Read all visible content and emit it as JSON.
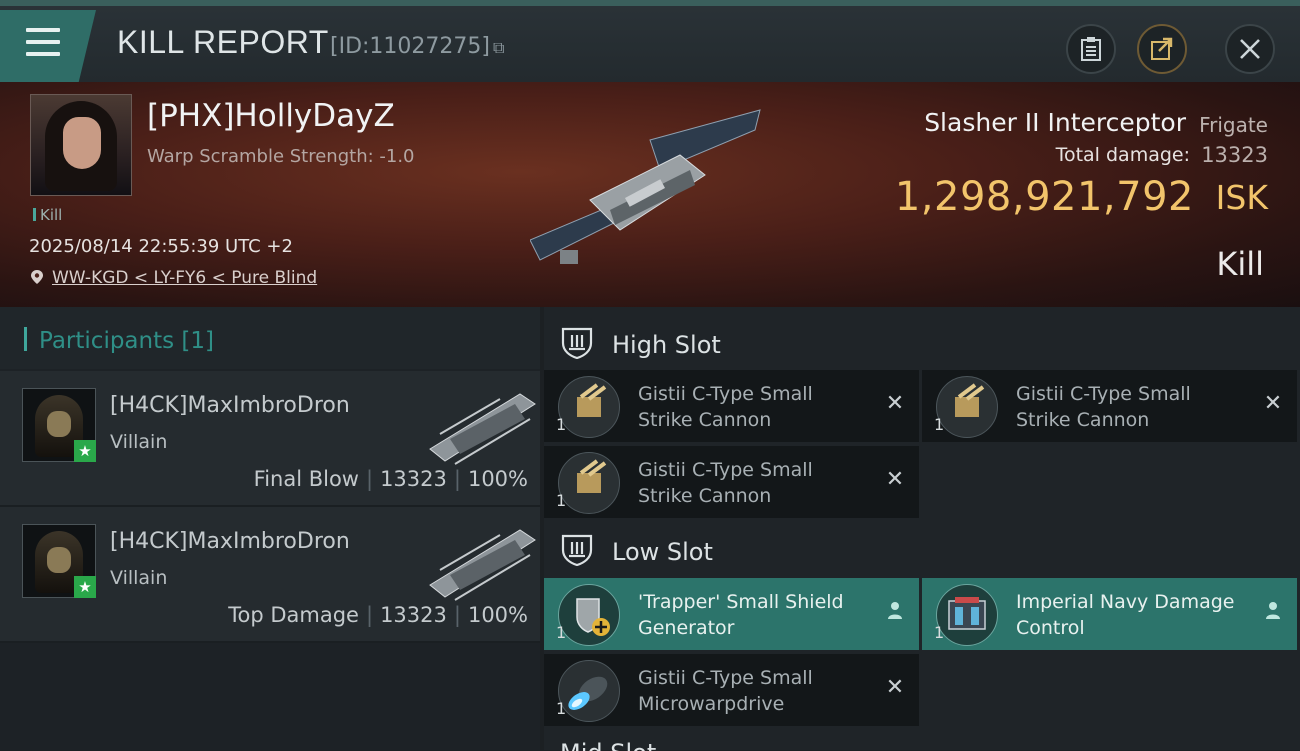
{
  "header": {
    "title": "KILL REPORT",
    "report_id": "[ID:11027275]",
    "buttons": {
      "menu": "menu-icon",
      "clipboard": "clipboard-icon",
      "share": "share-icon",
      "close": "close-icon"
    }
  },
  "victim": {
    "name": "[PHX]HollyDayZ",
    "scramble": "Warp Scramble Strength: -1.0",
    "tag": "Kill",
    "timestamp": "2025/08/14 22:55:39 UTC +2",
    "location": "WW-KGD < LY-FY6 < Pure Blind",
    "ship_name": "Slasher II Interceptor",
    "ship_class": "Frigate",
    "total_damage_label": "Total damage:",
    "total_damage": "13323",
    "isk_value": "1,298,921,792",
    "isk_label": "ISK",
    "result": "Kill"
  },
  "participants": {
    "title": "Participants [1]",
    "rows": [
      {
        "name": "[H4CK]MaxImbroDron",
        "role": "Villain",
        "blow": "Final Blow",
        "damage": "13323",
        "percent": "100%"
      },
      {
        "name": "[H4CK]MaxImbroDron",
        "role": "Villain",
        "blow": "Top Damage",
        "damage": "13323",
        "percent": "100%"
      }
    ]
  },
  "fitting": {
    "high_slot": {
      "label": "High Slot",
      "modules": [
        {
          "name": "Gistii C-Type Small Strike Cannon",
          "qty": "1",
          "state": "destroyed"
        },
        {
          "name": "Gistii C-Type Small Strike Cannon",
          "qty": "1",
          "state": "destroyed"
        },
        {
          "name": "Gistii C-Type Small Strike Cannon",
          "qty": "1",
          "state": "destroyed"
        }
      ]
    },
    "low_slot": {
      "label": "Low Slot",
      "modules": [
        {
          "name": "'Trapper' Small Shield Generator",
          "qty": "1",
          "state": "dropped"
        },
        {
          "name": "Imperial Navy Damage Control",
          "qty": "1",
          "state": "dropped"
        },
        {
          "name": "Gistii C-Type Small Microwarpdrive",
          "qty": "1",
          "state": "destroyed"
        }
      ]
    },
    "next_slot": "Mid Slot"
  },
  "colors": {
    "accent": "#2f8f87",
    "isk": "#f2c46b",
    "dropped": "#2c746b"
  }
}
